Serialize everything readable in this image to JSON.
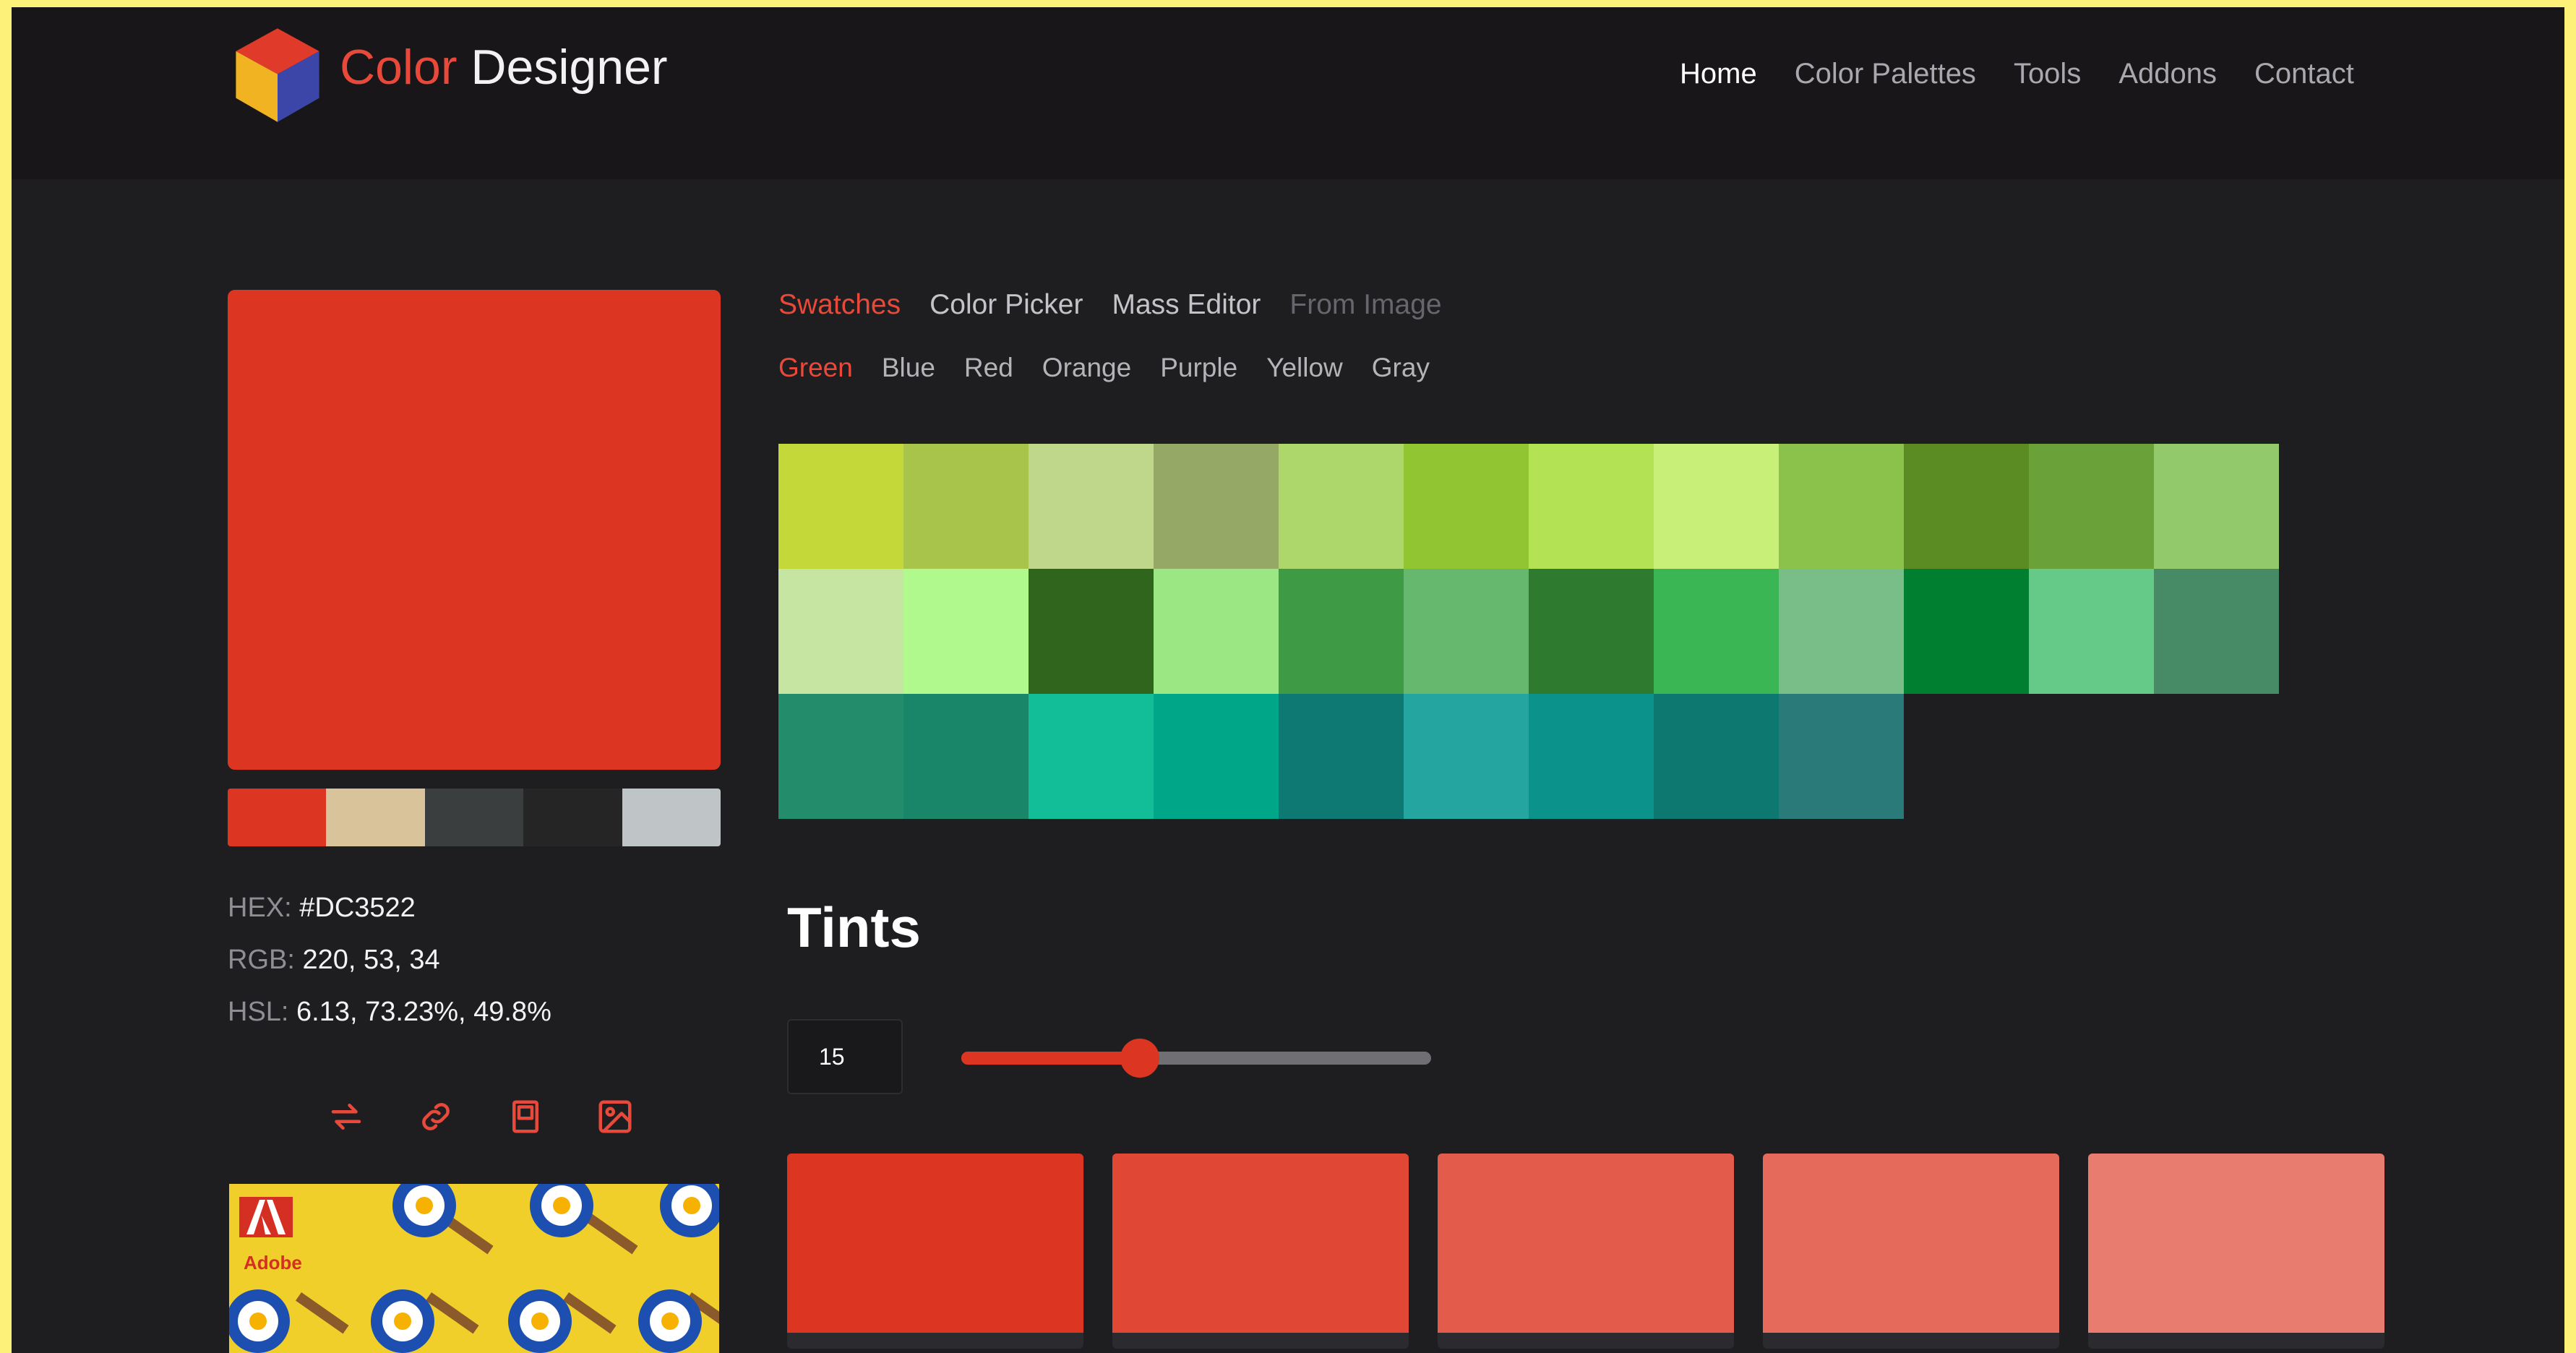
{
  "brand": {
    "accent": "Color",
    "rest": " Designer"
  },
  "nav": [
    "Home",
    "Color Palettes",
    "Tools",
    "Addons",
    "Contact"
  ],
  "selected_color": {
    "hex_label": "HEX:",
    "hex": "#DC3522",
    "rgb_label": "RGB:",
    "rgb": "220, 53, 34",
    "hsl_label": "HSL:",
    "hsl": "6.13, 73.23%, 49.8%"
  },
  "mini_palette": [
    "#dc3522",
    "#d9c39b",
    "#3a3e3f",
    "#252525",
    "#bfc4c6"
  ],
  "actions": [
    {
      "name": "swap-icon"
    },
    {
      "name": "link-icon"
    },
    {
      "name": "save-icon"
    },
    {
      "name": "image-icon"
    }
  ],
  "ad": {
    "brand_text": "Adobe"
  },
  "tabs": [
    "Swatches",
    "Color Picker",
    "Mass Editor",
    "From Image"
  ],
  "subtabs": [
    "Green",
    "Blue",
    "Red",
    "Orange",
    "Purple",
    "Yellow",
    "Gray"
  ],
  "swatches": [
    "#c4d939",
    "#a9c44a",
    "#bed78a",
    "#95a865",
    "#add76a",
    "#92c532",
    "#b3e354",
    "#c8ef78",
    "#8bc24c",
    "#5b8c24",
    "#6aa139",
    "#92c96b",
    "#c6e5a3",
    "#b0f98c",
    "#30651d",
    "#9be784",
    "#3e9a44",
    "#66b86e",
    "#2e7a2e",
    "#3ab754",
    "#79bd88",
    "#007f30",
    "#65c987",
    "#478a66",
    "#238d6b",
    "#19866a",
    "#12be98",
    "#00a688",
    "#0e7872",
    "#25a5a0",
    "#0b938b",
    "#0d7870",
    "#2b7a7a"
  ],
  "tints": {
    "title": "Tints",
    "count": "15",
    "slider_fraction": 0.38,
    "colors": [
      "#dc3522",
      "#e14735",
      "#e35b4a",
      "#e66a5c",
      "#e87c6f"
    ]
  },
  "colors": {
    "accent": "#e8493a",
    "background": "#1e1e21",
    "header": "#181618"
  }
}
